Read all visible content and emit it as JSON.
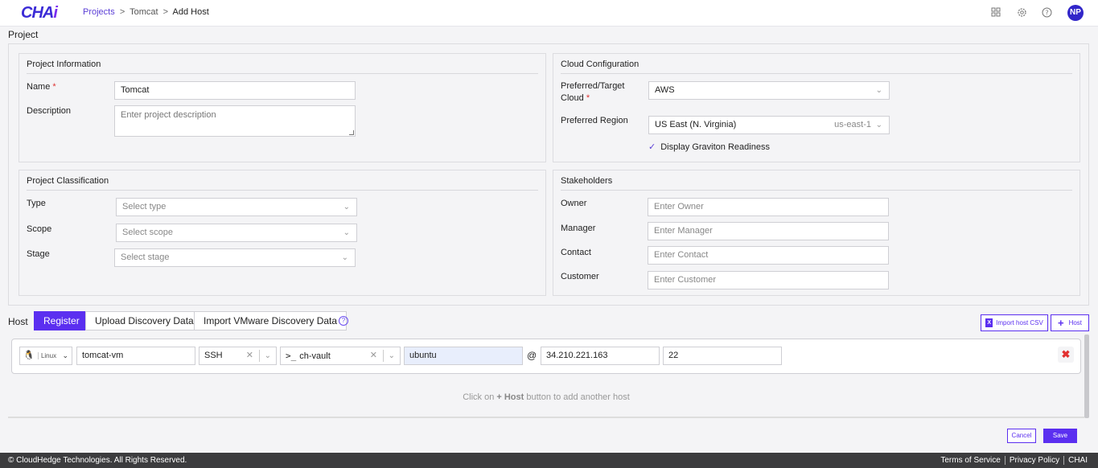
{
  "app": {
    "logo_main": "CHA",
    "logo_accent": "i"
  },
  "breadcrumb": {
    "projects": "Projects",
    "sep1": ">",
    "project": "Tomcat",
    "sep2": ">",
    "current": "Add Host"
  },
  "header": {
    "avatar": "NP",
    "icons": [
      "grid-icon",
      "gear-icon",
      "help-icon"
    ]
  },
  "page": {
    "title": "Project"
  },
  "project_information": {
    "title": "Project Information",
    "name_label": "Name",
    "required_mark": "*",
    "name_value": "Tomcat",
    "description_label": "Description",
    "description_placeholder": "Enter project description"
  },
  "cloud_configuration": {
    "title": "Cloud Configuration",
    "target_label_1": "Preferred/Target",
    "target_label_2": "Cloud",
    "target_value": "AWS",
    "region_label": "Preferred Region",
    "region_value": "US East (N. Virginia)",
    "region_code": "us-east-1",
    "graviton_label": "Display Graviton Readiness"
  },
  "project_classification": {
    "title": "Project Classification",
    "type_label": "Type",
    "type_placeholder": "Select type",
    "scope_label": "Scope",
    "scope_placeholder": "Select scope",
    "stage_label": "Stage",
    "stage_placeholder": "Select stage"
  },
  "stakeholders": {
    "title": "Stakeholders",
    "owner_label": "Owner",
    "owner_placeholder": "Enter Owner",
    "manager_label": "Manager",
    "manager_placeholder": "Enter Manager",
    "contact_label": "Contact",
    "contact_placeholder": "Enter Contact",
    "customer_label": "Customer",
    "customer_placeholder": "Enter Customer"
  },
  "host": {
    "label": "Host",
    "tabs": [
      "Register",
      "Upload Discovery Data",
      "Import VMware Discovery Data"
    ],
    "active_tab": 0,
    "import_csv_label": "Import host CSV",
    "add_host_label": "Host",
    "row": {
      "os": "Linux",
      "hostname": "tomcat-vm",
      "protocol": "SSH",
      "vault": "ch-vault",
      "user": "ubuntu",
      "at": "@",
      "ip": "34.210.221.163",
      "port": "22"
    },
    "hint_prefix": "Click on",
    "hint_bold": "+ Host",
    "hint_suffix": "button to add another host"
  },
  "actions": {
    "cancel": "Cancel",
    "save": "Save"
  },
  "footer": {
    "copyright": "© CloudHedge Technologies. All Rights Reserved.",
    "terms": "Terms of Service",
    "privacy": "Privacy Policy",
    "brand": "CHAI"
  }
}
